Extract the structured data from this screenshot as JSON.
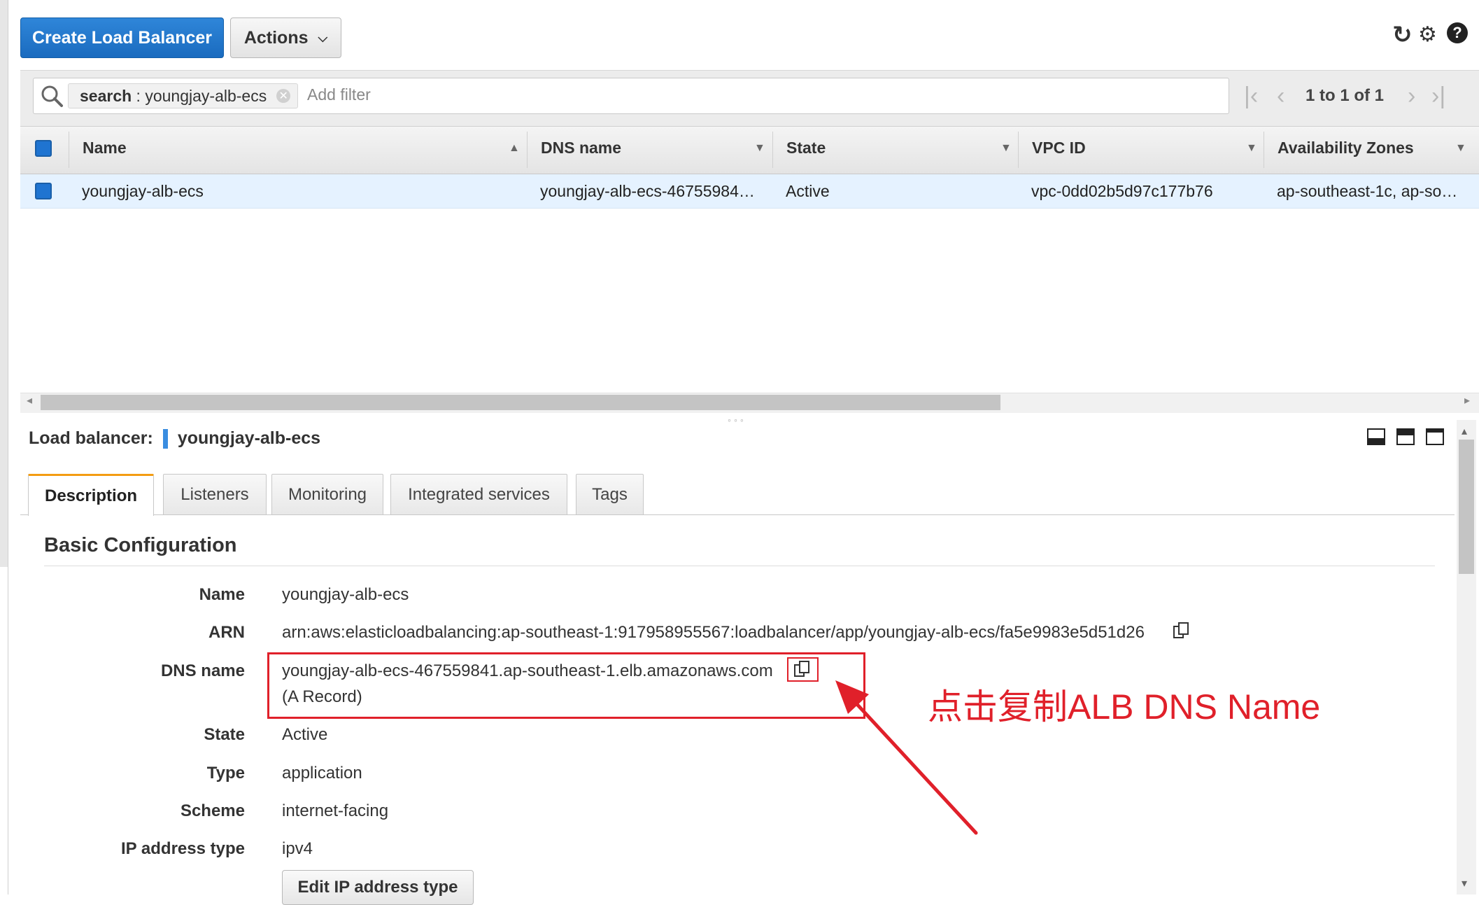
{
  "toolbar": {
    "create_label": "Create Load Balancer",
    "actions_label": "Actions",
    "icons": [
      "refresh-icon",
      "gear-icon",
      "help-icon"
    ]
  },
  "filter": {
    "token_key": "search",
    "token_separator": " : ",
    "token_value": "youngjay-alb-ecs",
    "placeholder": "Add filter"
  },
  "pagination": {
    "text": "1 to 1 of 1"
  },
  "table": {
    "columns": [
      "Name",
      "DNS name",
      "State",
      "VPC ID",
      "Availability Zones"
    ],
    "rows": [
      {
        "name": "youngjay-alb-ecs",
        "dns": "youngjay-alb-ecs-46755984…",
        "state": "Active",
        "vpc": "vpc-0dd02b5d97c177b76",
        "az": "ap-southeast-1c, ap-so…"
      }
    ]
  },
  "detail": {
    "label": "Load balancer:",
    "name": "youngjay-alb-ecs",
    "tabs": [
      "Description",
      "Listeners",
      "Monitoring",
      "Integrated services",
      "Tags"
    ],
    "section_title": "Basic Configuration",
    "fields": {
      "name_label": "Name",
      "name_value": "youngjay-alb-ecs",
      "arn_label": "ARN",
      "arn_value": "arn:aws:elasticloadbalancing:ap-southeast-1:917958955567:loadbalancer/app/youngjay-alb-ecs/fa5e9983e5d51d26",
      "dns_label": "DNS name",
      "dns_value": "youngjay-alb-ecs-467559841.ap-southeast-1.elb.amazonaws.com",
      "dns_record": "(A Record)",
      "state_label": "State",
      "state_value": "Active",
      "type_label": "Type",
      "type_value": "application",
      "scheme_label": "Scheme",
      "scheme_value": "internet-facing",
      "ip_label": "IP address type",
      "ip_value": "ipv4",
      "edit_ip_button": "Edit IP address type"
    }
  },
  "annotation": {
    "text": "点击复制ALB DNS Name",
    "color": "#e0202a"
  },
  "colors": {
    "primary": "#1a6bbf",
    "selected_row": "#e5f2ff",
    "active_tab_accent": "#f39c12"
  }
}
